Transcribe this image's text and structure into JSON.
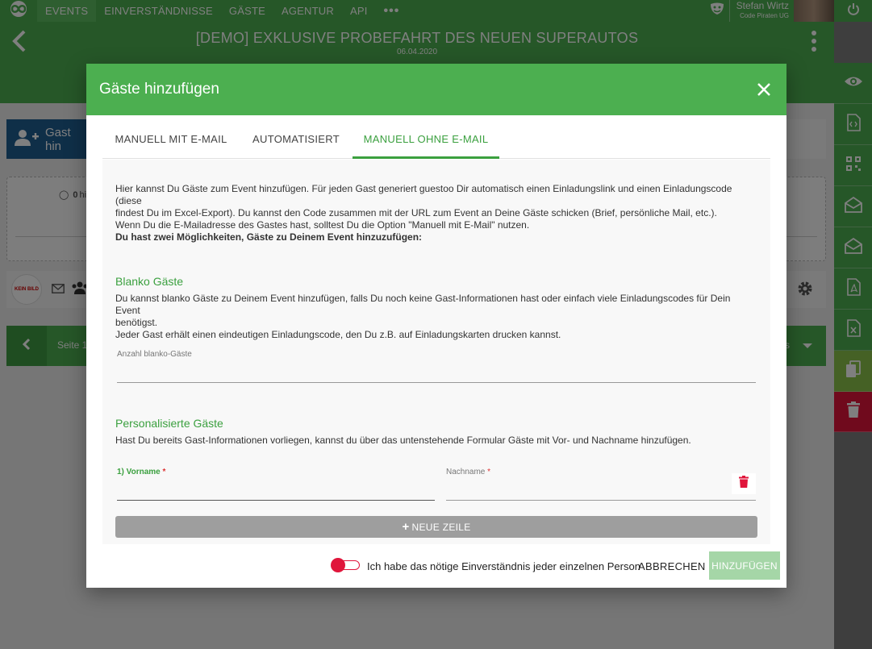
{
  "topnav": {
    "items": [
      "EVENTS",
      "EINVERSTÄNDNISSE",
      "GÄSTE",
      "AGENTUR",
      "API"
    ],
    "more": "•••",
    "user_name": "Stefan Wirtz",
    "user_org": "Code Piraten UG"
  },
  "event": {
    "title": "[DEMO] EXKLUSIVE PROBEFAHRT DES NEUEN SUPERAUTOS",
    "date": "06.04.2020"
  },
  "background": {
    "add_guest_label": "Gast hin",
    "radio_count": "0",
    "radio_text": "hi",
    "no_image": "KEIN BILD",
    "pager_text": "Seite 1",
    "pager_right": "s"
  },
  "modal": {
    "title": "Gäste hinzufügen",
    "tabs": [
      "MANUELL MIT E-MAIL",
      "AUTOMATISIERT",
      "MANUELL OHNE E-MAIL"
    ],
    "active_tab": "MANUELL OHNE E-MAIL",
    "intro_line1": "Hier kannst Du Gäste zum Event hinzufügen. Für jeden Gast generiert guestoo Dir automatisch einen Einladungslink und einen Einladungscode (diese",
    "intro_line2": "findest Du im Excel-Export). Du kannst den Code zusammen mit der URL zum Event an Deine Gäste schicken (Brief, persönliche Mail, etc.).",
    "intro_line3": "Wenn Du die E-Mailadresse des Gastes hast, solltest Du die Option \"Manuell mit E-Mail\" nutzen.",
    "intro_bold": "Du hast zwei Möglichkeiten, Gäste zu Deinem Event hinzuzufügen:",
    "blank": {
      "title": "Blanko Gäste",
      "desc_line1": "Du kannst blanko Gäste zu Deinem Event hinzufügen, falls Du noch keine Gast-Informationen hast oder einfach viele Einladungscodes für Dein Event",
      "desc_line2": "benötigst.",
      "desc_line3": "Jeder Gast erhält einen eindeutigen Einladungscode, den Du z.B. auf Einladungskarten drucken kannst.",
      "field_label": "Anzahl blanko-Gäste",
      "field_value": ""
    },
    "personal": {
      "title": "Personalisierte Gäste",
      "desc": "Hast Du bereits Gast-Informationen vorliegen, kannst du über das untenstehende Formular Gäste mit Vor- und Nachname hinzufügen.",
      "firstname_label": "1) Vorname",
      "lastname_label": "Nachname",
      "required_mark": "*",
      "firstname_value": "",
      "lastname_value": ""
    },
    "new_row": "NEUE ZEILE",
    "consent": "Ich habe das nötige Einverständnis jeder einzelnen Person",
    "consent_checked": false,
    "cancel": "ABBRECHEN",
    "submit": "HINZUFÜGEN"
  },
  "colors": {
    "primary": "#4caf50",
    "accent_text": "#3ba03f",
    "danger": "#e0153b",
    "sidebar_blue": "#1f5e91",
    "sidebar_lime": "#8bc34a",
    "sidebar_red": "#e0153b"
  },
  "icons": {
    "logo": "infinity-logo-icon",
    "mask": "theater-mask-icon",
    "power": "power-icon",
    "back": "chevron-left-icon",
    "close": "close-icon",
    "trash": "trash-icon",
    "plus": "plus-icon",
    "sidebar": [
      "eye-icon",
      "code-file-icon",
      "qr-code-icon",
      "envelope-open-icon",
      "envelope-open-icon",
      "pdf-file-icon",
      "excel-file-icon",
      "copy-icon",
      "trash-icon"
    ]
  }
}
